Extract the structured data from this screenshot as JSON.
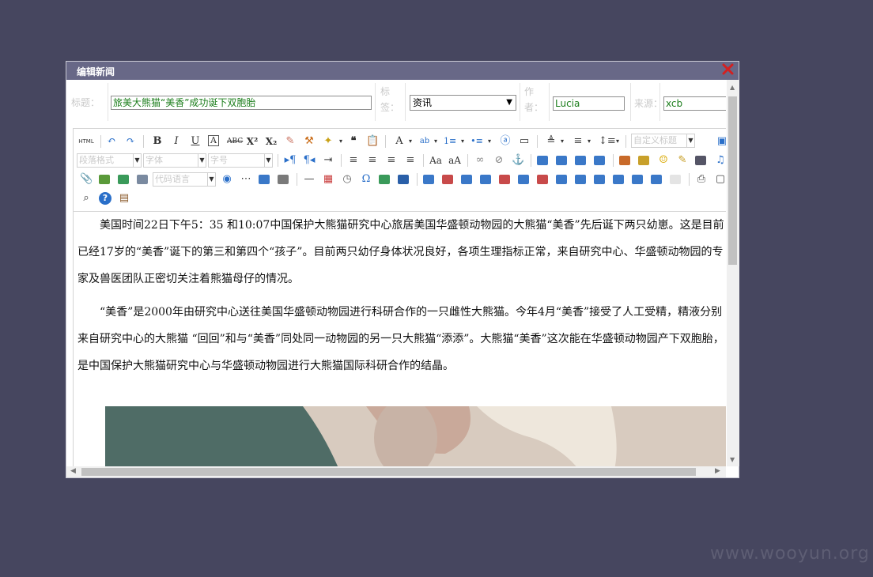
{
  "dialog": {
    "title": "编辑新闻",
    "close_icon": "close-x-icon",
    "close_color": "#d42020"
  },
  "form": {
    "title_label": "标题：",
    "title_value": "旅美大熊猫“美香”成功诞下双胞胎",
    "tag_label": "标签：",
    "tag_value": "资讯",
    "author_label": "作者：",
    "author_value": "Lucia",
    "source_label": "来源：",
    "source_value": "xcb"
  },
  "toolbar": {
    "html_label": "HTML",
    "custom_title_placeholder": "自定义标题",
    "paragraph_format_placeholder": "段落格式",
    "font_family_placeholder": "字体",
    "font_size_placeholder": "字号",
    "code_language_placeholder": "代码语言"
  },
  "content": {
    "para1": "美国时间22日下午5：35 和10:07中国保护大熊猫研究中心旅居美国华盛顿动物园的大熊猫“美香”先后诞下两只幼崽。这是目前已经17岁的“美香”诞下的第三和第四个“孩子”。目前两只幼仔身体状况良好，各项生理指标正常，来自研究中心、华盛顿动物园的专家及兽医团队正密切关注着熊猫母仔的情况。",
    "para2": "“美香”是2000年由研究中心送往美国华盛顿动物园进行科研合作的一只雌性大熊猫。今年4月“美香”接受了人工受精，精液分别来自研究中心的大熊猫 “回回”和与“美香”同处同一动物园的另一只大熊猫“添添”。大熊猫“美香”这次能在华盛顿动物园产下双胞胎，是中国保护大熊猫研究中心与华盛顿动物园进行大熊猫国际科研合作的结晶。"
  },
  "watermark": "www.wooyun.org"
}
